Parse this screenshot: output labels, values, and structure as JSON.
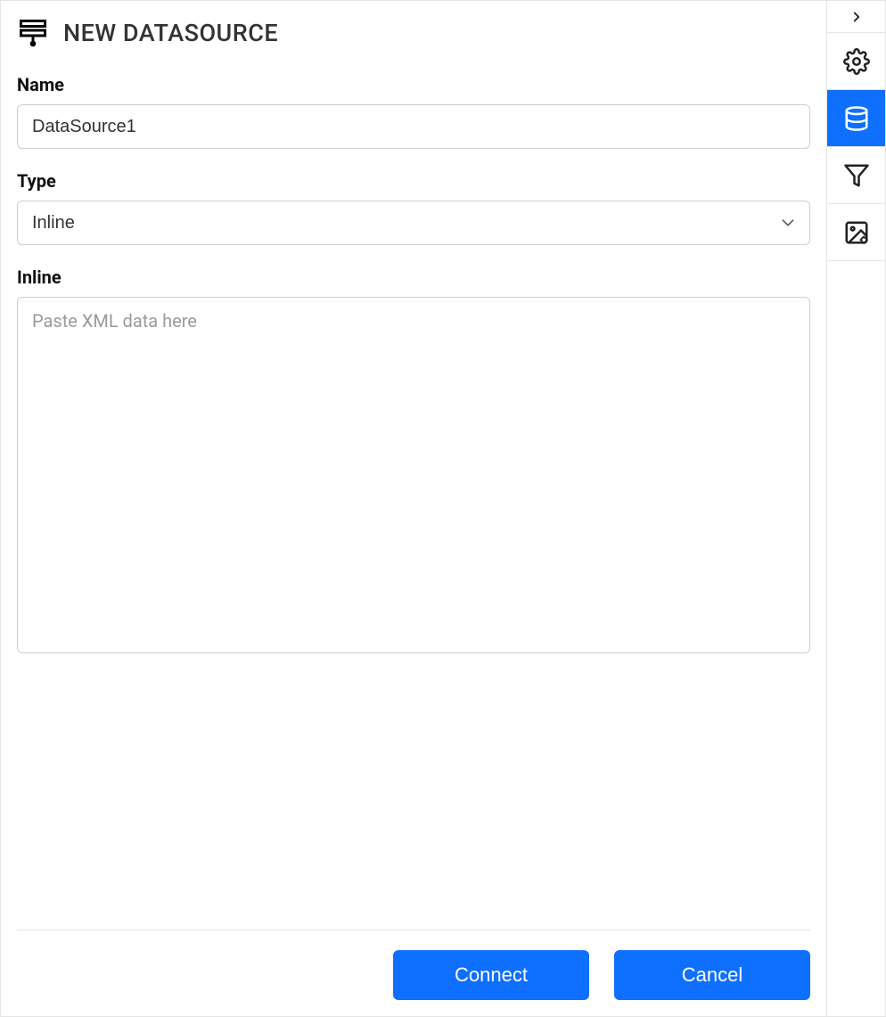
{
  "header": {
    "title": "NEW DATASOURCE"
  },
  "form": {
    "name_label": "Name",
    "name_value": "DataSource1",
    "type_label": "Type",
    "type_value": "Inline",
    "inline_label": "Inline",
    "inline_placeholder": "Paste XML data here"
  },
  "footer": {
    "connect_label": "Connect",
    "cancel_label": "Cancel"
  }
}
